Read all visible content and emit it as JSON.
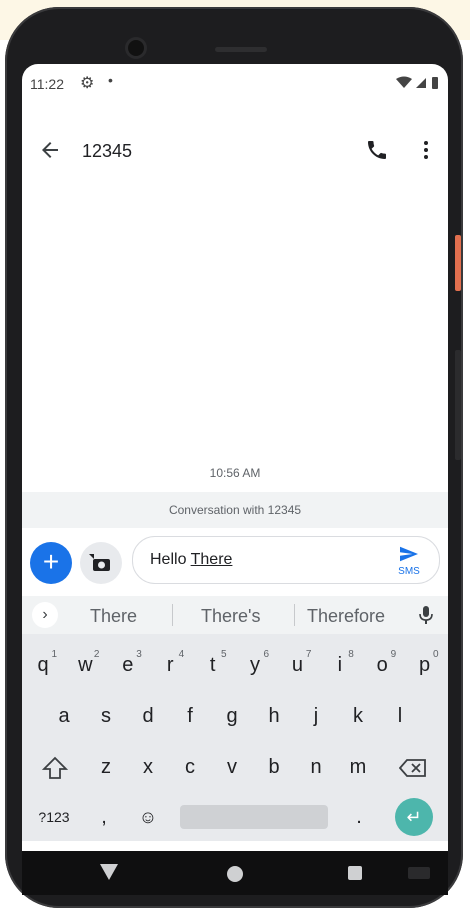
{
  "status": {
    "time": "11:22",
    "gear_icon": "gear-icon",
    "dot": "•"
  },
  "appbar": {
    "title": "12345"
  },
  "thread": {
    "timestamp": "10:56 AM",
    "conversation_label": "Conversation with 12345"
  },
  "compose": {
    "text_plain": "Hello ",
    "text_underlined": "There",
    "send_label": "SMS"
  },
  "keyboard": {
    "suggestions": [
      "There",
      "There's",
      "Therefore"
    ],
    "row1": [
      {
        "k": "q",
        "h": "1"
      },
      {
        "k": "w",
        "h": "2"
      },
      {
        "k": "e",
        "h": "3"
      },
      {
        "k": "r",
        "h": "4"
      },
      {
        "k": "t",
        "h": "5"
      },
      {
        "k": "y",
        "h": "6"
      },
      {
        "k": "u",
        "h": "7"
      },
      {
        "k": "i",
        "h": "8"
      },
      {
        "k": "o",
        "h": "9"
      },
      {
        "k": "p",
        "h": "0"
      }
    ],
    "row2": [
      "a",
      "s",
      "d",
      "f",
      "g",
      "h",
      "j",
      "k",
      "l"
    ],
    "row3": [
      "z",
      "x",
      "c",
      "v",
      "b",
      "n",
      "m"
    ],
    "symbols_label": "?123",
    "comma": ",",
    "period": "."
  },
  "colors": {
    "accent": "#1a73e8",
    "enter": "#4db6ac"
  }
}
